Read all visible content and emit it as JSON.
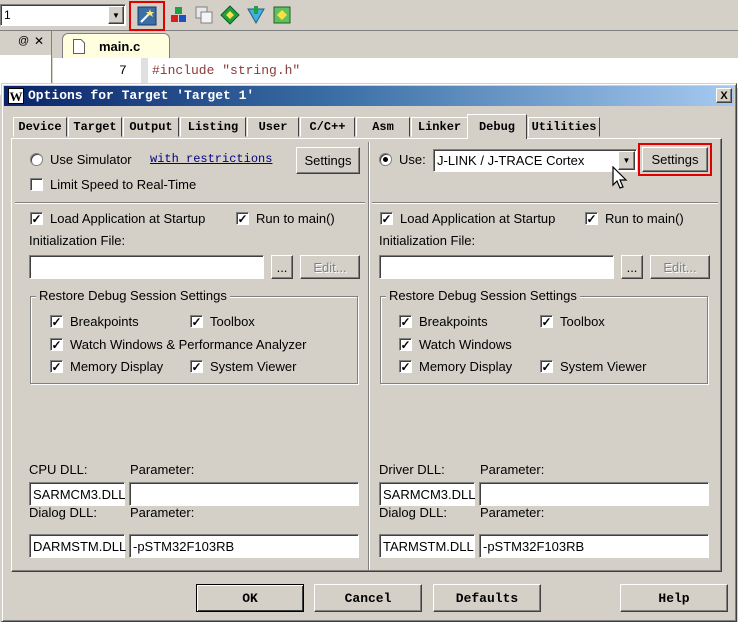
{
  "ide": {
    "target_combo": "1",
    "editor_tab": "main.c",
    "editor_line_no": "7",
    "editor_line_code": "#include \"string.h\"",
    "pane_pin": "@",
    "pane_close": "✕"
  },
  "dialog": {
    "title": "Options for Target 'Target 1'",
    "close": "X",
    "tabs": [
      "Device",
      "Target",
      "Output",
      "Listing",
      "User",
      "C/C++",
      "Asm",
      "Linker",
      "Debug",
      "Utilities"
    ],
    "active_tab": "Debug",
    "left": {
      "use_simulator_label": "Use Simulator",
      "restrictions_link": "with restrictions",
      "settings_button": "Settings",
      "limit_speed_label": "Limit Speed to Real-Time",
      "load_app_label": "Load Application at Startup",
      "run_to_main_label": "Run to main()",
      "init_file_label": "Initialization File:",
      "browse_button": "...",
      "edit_button": "Edit...",
      "restore_group_label": "Restore Debug Session Settings",
      "breakpoints_label": "Breakpoints",
      "toolbox_label": "Toolbox",
      "watch_label": "Watch Windows & Performance Analyzer",
      "memory_label": "Memory Display",
      "system_viewer_label": "System Viewer",
      "cpu_dll_label": "CPU DLL:",
      "cpu_param_label": "Parameter:",
      "cpu_dll_value": "SARMCM3.DLL",
      "cpu_param_value": "",
      "dialog_dll_label": "Dialog DLL:",
      "dialog_param_label": "Parameter:",
      "dialog_dll_value": "DARMSTM.DLL",
      "dialog_param_value": "-pSTM32F103RB"
    },
    "right": {
      "use_label": "Use:",
      "debugger_value": "J-LINK / J-TRACE Cortex",
      "settings_button": "Settings",
      "load_app_label": "Load Application at Startup",
      "run_to_main_label": "Run to main()",
      "init_file_label": "Initialization File:",
      "browse_button": "...",
      "edit_button": "Edit...",
      "restore_group_label": "Restore Debug Session Settings",
      "breakpoints_label": "Breakpoints",
      "toolbox_label": "Toolbox",
      "watch_label": "Watch Windows",
      "memory_label": "Memory Display",
      "system_viewer_label": "System Viewer",
      "driver_dll_label": "Driver DLL:",
      "driver_param_label": "Parameter:",
      "driver_dll_value": "SARMCM3.DLL",
      "driver_param_value": "",
      "dialog_dll_label": "Dialog DLL:",
      "dialog_param_label": "Parameter:",
      "dialog_dll_value": "TARMSTM.DLL",
      "dialog_param_value": "-pSTM32F103RB"
    },
    "footer": {
      "ok": "OK",
      "cancel": "Cancel",
      "defaults": "Defaults",
      "help": "Help"
    }
  },
  "colors": {
    "title_bar": "#0a246a",
    "highlight_box": "#e00000",
    "link": "#000080"
  }
}
